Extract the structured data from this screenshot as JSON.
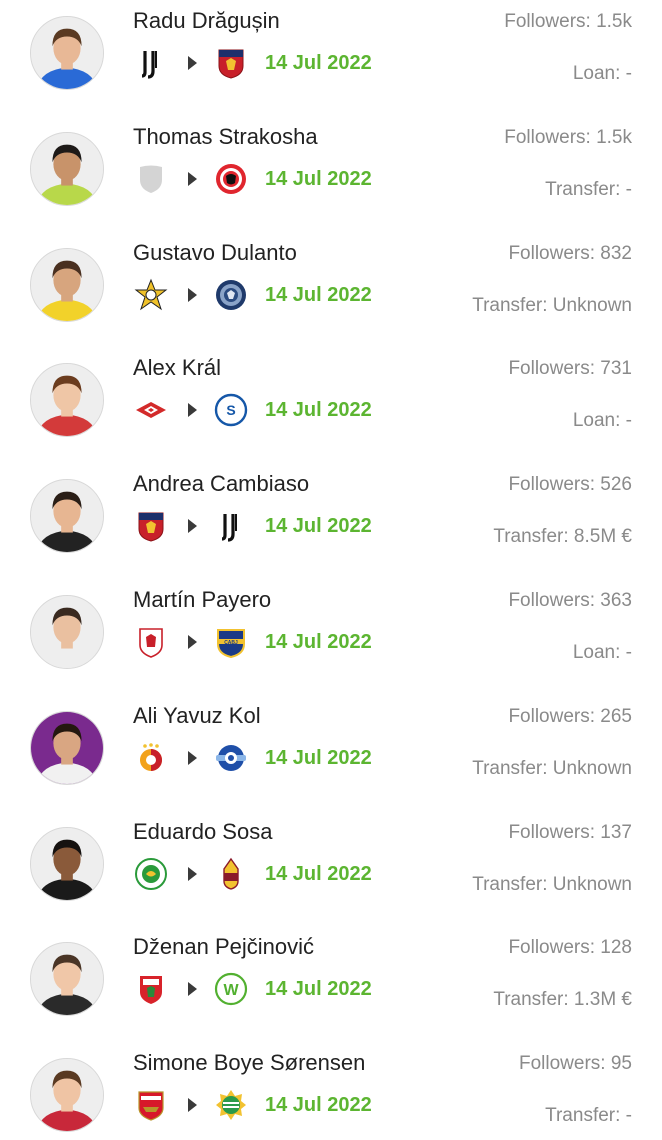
{
  "transfers": [
    {
      "name": "Radu Drăgușin",
      "followers": "Followers: 1.5k",
      "fee": "Loan: -",
      "date": "14 Jul 2022",
      "from_icon": "juventus-crest-icon",
      "to_icon": "genoa-crest-icon",
      "skin": "#e8b896",
      "hair": "#5a3a22",
      "shirt": "#2a6ad6",
      "bg": "#eeeeee"
    },
    {
      "name": "Thomas Strakosha",
      "followers": "Followers: 1.5k",
      "fee": "Transfer: -",
      "date": "14 Jul 2022",
      "from_icon": "placeholder-crest-icon",
      "to_icon": "brentford-crest-icon",
      "skin": "#c8936a",
      "hair": "#1e1a18",
      "shirt": "#b8d84a",
      "bg": "#eeeeee"
    },
    {
      "name": "Gustavo Dulanto",
      "followers": "Followers: 832",
      "fee": "Transfer: Unknown",
      "date": "14 Jul 2022",
      "from_icon": "sheriff-crest-icon",
      "to_icon": "lion-club-crest-icon",
      "skin": "#d7a57e",
      "hair": "#4a3020",
      "shirt": "#f2d22a",
      "bg": "#eeeeee"
    },
    {
      "name": "Alex Král",
      "followers": "Followers: 731",
      "fee": "Loan: -",
      "date": "14 Jul 2022",
      "from_icon": "spartak-crest-icon",
      "to_icon": "schalke-crest-icon",
      "skin": "#efc6a6",
      "hair": "#6b3c1e",
      "shirt": "#d33a3a",
      "bg": "#eeeeee"
    },
    {
      "name": "Andrea Cambiaso",
      "followers": "Followers: 526",
      "fee": "Transfer: 8.5M €",
      "date": "14 Jul 2022",
      "from_icon": "genoa-crest-icon",
      "to_icon": "juventus-crest-icon",
      "skin": "#e7b692",
      "hair": "#2a1e16",
      "shirt": "#222222",
      "bg": "#eeeeee"
    },
    {
      "name": "Martín Payero",
      "followers": "Followers: 363",
      "fee": "Loan: -",
      "date": "14 Jul 2022",
      "from_icon": "middlesbrough-crest-icon",
      "to_icon": "boca-juniors-crest-icon",
      "skin": "#eac0a0",
      "hair": "#3a2a20",
      "shirt": "#eeeeee",
      "bg": "#eeeeee"
    },
    {
      "name": "Ali Yavuz Kol",
      "followers": "Followers: 265",
      "fee": "Transfer: Unknown",
      "date": "14 Jul 2022",
      "from_icon": "galatasaray-crest-icon",
      "to_icon": "adana-demirspor-crest-icon",
      "skin": "#d9a682",
      "hair": "#24180f",
      "shirt": "#f1f1f1",
      "bg": "#7a2a8e"
    },
    {
      "name": "Eduardo Sosa",
      "followers": "Followers: 137",
      "fee": "Transfer: Unknown",
      "date": "14 Jul 2022",
      "from_icon": "jaguares-crest-icon",
      "to_icon": "tolima-crest-icon",
      "skin": "#8a5a3a",
      "hair": "#161210",
      "shirt": "#1a1a1a",
      "bg": "#eeeeee"
    },
    {
      "name": "Dženan Pejčinović",
      "followers": "Followers: 128",
      "fee": "Transfer: 1.3M €",
      "date": "14 Jul 2022",
      "from_icon": "augsburg-crest-icon",
      "to_icon": "wolfsburg-crest-icon",
      "skin": "#f0c7a8",
      "hair": "#4a3526",
      "shirt": "#2a2a2a",
      "bg": "#eeeeee"
    },
    {
      "name": "Simone Boye Sørensen",
      "followers": "Followers: 95",
      "fee": "Transfer: -",
      "date": "14 Jul 2022",
      "from_icon": "arsenal-crest-icon",
      "to_icon": "hammarby-crest-icon",
      "skin": "#efc4a4",
      "hair": "#5a3a22",
      "shirt": "#c8283a",
      "bg": "#eeeeee"
    }
  ],
  "colors": {
    "date": "#5cb531",
    "muted": "#8a8a8a",
    "text": "#222222"
  }
}
